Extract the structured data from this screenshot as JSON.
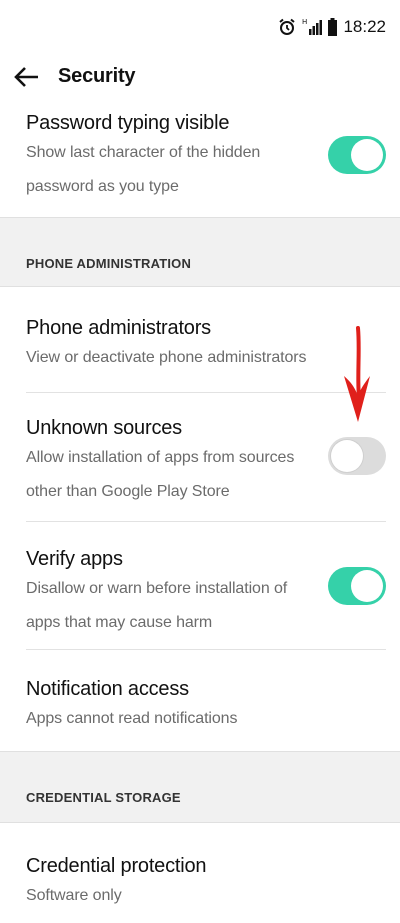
{
  "status_bar": {
    "time": "18:22",
    "icons": [
      "alarm-icon",
      "signal-icon",
      "battery-icon"
    ]
  },
  "header": {
    "title": "Security",
    "back_icon": "arrow-left-icon"
  },
  "settings": {
    "password_visible": {
      "title": "Password typing visible",
      "subtitle_line1": "Show last character of the hidden",
      "subtitle_line2": "password as you type",
      "toggle": "on"
    },
    "section_phone_admin": "PHONE ADMINISTRATION",
    "phone_admins": {
      "title": "Phone administrators",
      "subtitle": "View or deactivate phone administrators"
    },
    "unknown_sources": {
      "title": "Unknown sources",
      "subtitle_line1": "Allow installation of apps from sources",
      "subtitle_line2": "other than Google Play Store",
      "toggle": "off"
    },
    "verify_apps": {
      "title": "Verify apps",
      "subtitle_line1": "Disallow or warn before installation of",
      "subtitle_line2": "apps that may cause harm",
      "toggle": "on"
    },
    "notification_access": {
      "title": "Notification access",
      "subtitle": "Apps cannot read notifications"
    },
    "section_credential": "CREDENTIAL STORAGE",
    "credential_protection": {
      "title": "Credential protection",
      "subtitle": "Software only"
    }
  },
  "colors": {
    "toggle_on": "#35d1a9",
    "toggle_off": "#dcdcdc",
    "annotation_arrow": "#e0201b",
    "section_bg": "#f1f1f1"
  }
}
